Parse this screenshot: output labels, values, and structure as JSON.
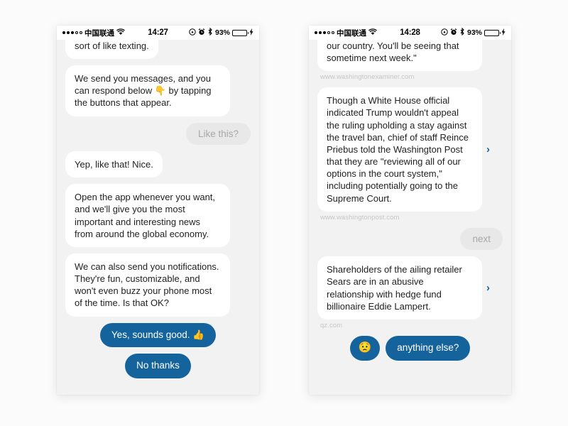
{
  "phones": [
    {
      "id": "left-phone",
      "status_bar": {
        "signal_filled_dots": 3,
        "signal_hollow_dots": 2,
        "carrier": "中国联通",
        "wifi_icon": "wifi-icon",
        "time": "14:27",
        "rotation_lock_icon": "rotation-lock-icon",
        "alarm_icon": "alarm-clock-icon",
        "bluetooth_icon": "bluetooth-icon",
        "battery_percent": "93%",
        "battery_level": 93,
        "charging_icon": "charging-bolt-icon"
      },
      "messages": [
        {
          "type": "incoming-clipped",
          "text": "sort of like texting."
        },
        {
          "type": "incoming",
          "text": "We send you messages, and you can respond below 👇 by tapping the buttons that appear."
        },
        {
          "type": "outgoing-pending",
          "text": "Like this?"
        },
        {
          "type": "incoming",
          "text": "Yep, like that! Nice."
        },
        {
          "type": "incoming",
          "text": "Open the app whenever you want, and we'll give you the most important and interesting news from around the global economy."
        },
        {
          "type": "incoming",
          "text": "We can also send you notifications. They're fun, customizable, and won't even buzz your phone most of the time. Is that OK?"
        }
      ],
      "reply_buttons": [
        {
          "label": "Yes, sounds good. 👍",
          "name": "reply-yes-sounds-good"
        },
        {
          "label": "No thanks",
          "name": "reply-no-thanks"
        }
      ]
    },
    {
      "id": "right-phone",
      "status_bar": {
        "signal_filled_dots": 3,
        "signal_hollow_dots": 2,
        "carrier": "中国联通",
        "wifi_icon": "wifi-icon",
        "time": "14:28",
        "rotation_lock_icon": "rotation-lock-icon",
        "alarm_icon": "alarm-clock-icon",
        "bluetooth_icon": "bluetooth-icon",
        "battery_percent": "93%",
        "battery_level": 93,
        "charging_icon": "charging-bolt-icon"
      },
      "messages": [
        {
          "type": "incoming-clipped",
          "text": "our country. You'll be seeing that sometime next week.\"",
          "source": "www.washingtonexaminer.com",
          "has_chevron": false
        },
        {
          "type": "incoming-article",
          "text": "Though a White House official indicated Trump wouldn't appeal the ruling upholding a stay against the travel ban, chief of staff Reince Priebus told the Washington Post that they are \"reviewing all of our options in the court system,\" including potentially going to the Supreme Court.",
          "source": "www.washingtonpost.com",
          "has_chevron": true
        },
        {
          "type": "outgoing-pending",
          "text": "next"
        },
        {
          "type": "incoming-article",
          "text": "Shareholders of the ailing retailer Sears are in an abusive relationship with hedge fund billionaire Eddie Lampert.",
          "source": "qz.com",
          "has_chevron": true
        }
      ],
      "reply_buttons": [
        {
          "label": "😟",
          "name": "reply-worried-emoji"
        },
        {
          "label": "anything else?",
          "name": "reply-anything-else"
        }
      ]
    }
  ],
  "colors": {
    "accent_blue": "#15639c",
    "chevron_blue": "#1565a0",
    "bubble_white": "#ffffff",
    "chat_background": "#f2f2f2",
    "page_background": "#fbfbfb",
    "pending_pill": "#e8e8e8",
    "pending_text": "#a8a8a8",
    "caption_grey": "#c6c6c6",
    "battery_green": "#43d15a"
  }
}
